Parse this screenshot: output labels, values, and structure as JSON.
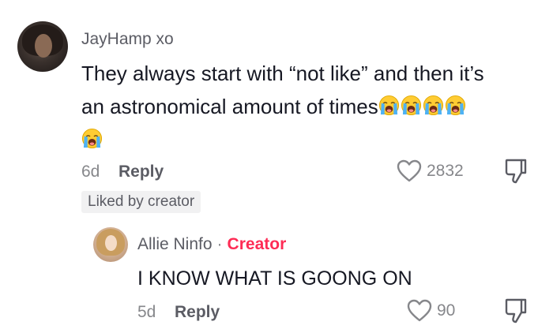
{
  "comment": {
    "username": "JayHamp xo",
    "text_line1": "They always start with “not like” and then it’s",
    "text_line2": "an astronomical amount of times",
    "emoji_name": "loudly-crying-face-emoji",
    "emoji_count_line2": 4,
    "emoji_count_line3": 1,
    "age": "6d",
    "reply_label": "Reply",
    "like_count": "2832",
    "badge": "Liked by creator"
  },
  "reply": {
    "username": "Allie Ninfo",
    "separator": "·",
    "creator_label": "Creator",
    "text": "I KNOW WHAT IS GOONG ON",
    "age": "5d",
    "reply_label": "Reply",
    "like_count": "90"
  },
  "colors": {
    "creator_accent": "#fe2c55",
    "username_gray": "#5b5c64",
    "meta_gray": "#86878b",
    "text": "#161823",
    "badge_bg": "#f1f1f2"
  },
  "icons": {
    "like": "heart-outline-icon",
    "dislike": "thumbs-down-outline-icon"
  }
}
